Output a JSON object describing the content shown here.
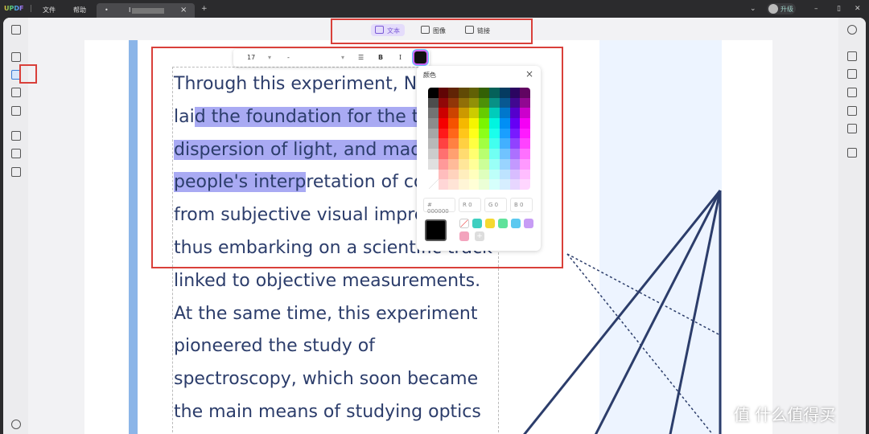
{
  "titlebar": {
    "logo": "UPDF",
    "menus": [
      "文件",
      "帮助"
    ],
    "tab_title": "I",
    "upgrade": "升级"
  },
  "toolbar": {
    "modes": [
      {
        "label": "文本",
        "icon": "text-icon",
        "active": true
      },
      {
        "label": "图像",
        "icon": "image-icon",
        "active": false
      },
      {
        "label": "链接",
        "icon": "link-icon",
        "active": false
      }
    ]
  },
  "format_toolbar": {
    "font_size": "17",
    "font_family": "-",
    "bold": "B",
    "italic": "I"
  },
  "document": {
    "lines": [
      {
        "parts": [
          {
            "t": "Through this experiment, N",
            "h": false
          }
        ]
      },
      {
        "parts": [
          {
            "t": "lai",
            "h": false
          },
          {
            "t": "d the foundation for the t",
            "h": true
          }
        ]
      },
      {
        "parts": [
          {
            "t": "dispersion of light, and mad",
            "h": true
          }
        ]
      },
      {
        "parts": [
          {
            "t": "people's interp",
            "h": true
          },
          {
            "t": "retation of co",
            "h": false
          }
        ]
      },
      {
        "parts": [
          {
            "t": "from subjective visual impre",
            "h": false
          }
        ]
      },
      {
        "parts": [
          {
            "t": "thus embarking on a scientific track",
            "h": false
          }
        ]
      },
      {
        "parts": [
          {
            "t": "linked to objective measurements.",
            "h": false
          }
        ]
      },
      {
        "parts": [
          {
            "t": "At the same time, this experiment",
            "h": false
          }
        ]
      },
      {
        "parts": [
          {
            "t": "pioneered the study of",
            "h": false
          }
        ]
      },
      {
        "parts": [
          {
            "t": "spectroscopy, which soon became",
            "h": false
          }
        ]
      },
      {
        "parts": [
          {
            "t": "the main means of studying optics",
            "h": false
          }
        ]
      }
    ]
  },
  "color_picker": {
    "title": "颜色",
    "hex": "# 000000",
    "r": "R 0",
    "g": "G 0",
    "b": "B 0",
    "current_color": "#000000",
    "swatches": [
      "#3ecfc0",
      "#f5d930",
      "#5fe29b",
      "#5cc9f0",
      "#c79cf5",
      "#f3a3bd"
    ]
  },
  "colors": {
    "accent": "#7a5ad6",
    "highlight": "#a9aaf3",
    "text": "#2c3d6b",
    "annotation": "#d9403a"
  },
  "watermark": "值 什么值得买"
}
